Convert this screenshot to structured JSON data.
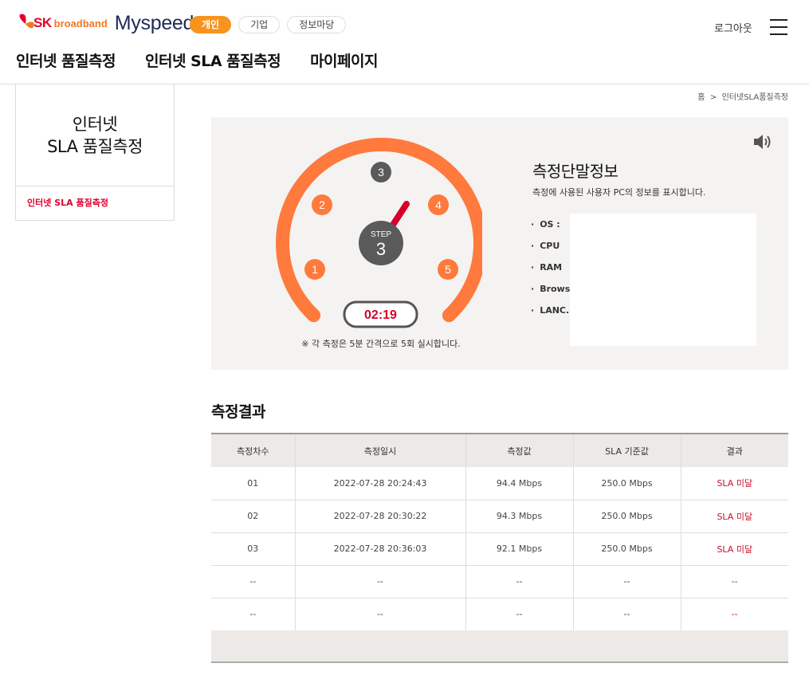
{
  "header": {
    "logo_sk": "SK",
    "logo_broadband": "broadband",
    "logo_myspeed": "Myspeed",
    "segments": [
      "개인",
      "기업",
      "정보마당"
    ],
    "logout": "로그아웃",
    "nav": [
      "인터넷 품질측정",
      "인터넷 SLA 품질측정",
      "마이페이지"
    ]
  },
  "sidebar": {
    "title_line1": "인터넷",
    "title_line2": "SLA 품질측정",
    "item": "인터넷 SLA 품질측정"
  },
  "breadcrumb": {
    "home": "홈",
    "sep": ">",
    "current": "인터넷SLA품질측정"
  },
  "gauge": {
    "steps": [
      "1",
      "2",
      "3",
      "4",
      "5"
    ],
    "current_step_label": "STEP",
    "current_step": "3",
    "timer": "02:19",
    "note": "※ 각 측정은 5분 간격으로 5회 실시합니다.",
    "arc_color": "#ff7a3c",
    "needle_color": "#d6002a"
  },
  "device_info": {
    "title": "측정단말정보",
    "subtitle": "측정에 사용된 사용자 PC의 정보를 표시합니다.",
    "items": [
      "OS  :",
      "CPU",
      "RAM",
      "Brows",
      "LANC."
    ]
  },
  "results": {
    "title": "측정결과",
    "headers": [
      "측정차수",
      "측정일시",
      "측정값",
      "SLA 기준값",
      "결과"
    ],
    "rows": [
      [
        "01",
        "2022-07-28 20:24:43",
        "94.4 Mbps",
        "250.0 Mbps",
        "SLA 미달"
      ],
      [
        "02",
        "2022-07-28 20:30:22",
        "94.3 Mbps",
        "250.0 Mbps",
        "SLA 미달"
      ],
      [
        "03",
        "2022-07-28 20:36:03",
        "92.1 Mbps",
        "250.0 Mbps",
        "SLA 미달"
      ],
      [
        "--",
        "--",
        "--",
        "--",
        "--"
      ],
      [
        "--",
        "--",
        "--",
        "--",
        "--"
      ]
    ]
  }
}
